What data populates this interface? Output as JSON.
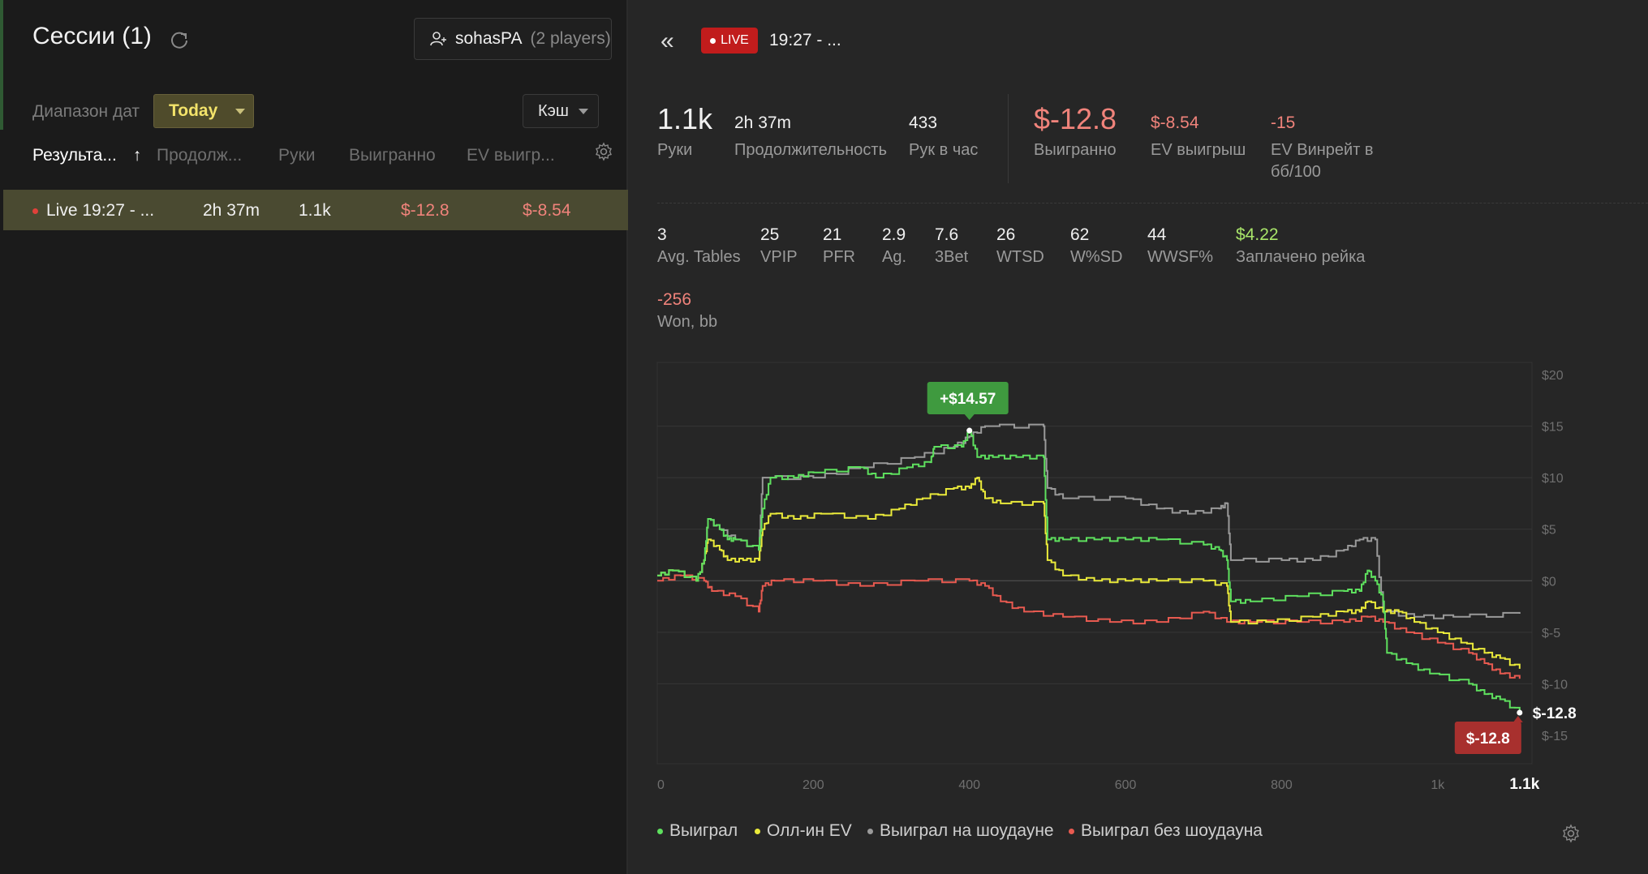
{
  "left": {
    "title": "Сессии (1)",
    "player": {
      "name": "sohasPA",
      "sub": "(2 players)"
    },
    "date_label": "Диапазон дат",
    "date_value": "Today",
    "game_type": "Кэш",
    "columns": [
      "Результа...",
      "Продолж...",
      "Руки",
      "Выигранно",
      "EV выигр..."
    ],
    "sort_arrow": "↑",
    "rows": [
      {
        "name": "Live 19:27 - ...",
        "duration": "2h 37m",
        "hands": "1.1k",
        "won": "$-12.8",
        "ev_won": "$-8.54"
      }
    ]
  },
  "header": {
    "live_label": "LIVE",
    "session_title": "19:27 - ..."
  },
  "stats": {
    "hands_value": "1.1k",
    "hands_label": "Руки",
    "duration_value": "2h 37m",
    "duration_label": "Продолжительность",
    "hph_value": "433",
    "hph_label": "Рук в час",
    "won_value": "$-12.8",
    "won_label": "Выигранно",
    "ev_value": "$-8.54",
    "ev_label": "EV выигрыш",
    "evwr_value": "-15",
    "evwr_label_1": "EV Винрейт в",
    "evwr_label_2": "бб/100",
    "row2": [
      {
        "v": "3",
        "l": "Avg. Tables"
      },
      {
        "v": "25",
        "l": "VPIP"
      },
      {
        "v": "21",
        "l": "PFR"
      },
      {
        "v": "2.9",
        "l": "Ag."
      },
      {
        "v": "7.6",
        "l": "3Bet"
      },
      {
        "v": "26",
        "l": "WTSD"
      },
      {
        "v": "62",
        "l": "W%SD"
      },
      {
        "v": "44",
        "l": "WWSF%"
      },
      {
        "v": "$4.22",
        "l": "Заплачено рейка"
      }
    ],
    "won_bb_value": "-256",
    "won_bb_label": "Won, bb"
  },
  "colors": {
    "won": "#5ee05e",
    "allin_ev": "#eaea3a",
    "showdown": "#9a9a9a",
    "non_showdown": "#e85a50",
    "peak_badge": "#3f9a3f",
    "end_badge": "#a8302e"
  },
  "chart_data": {
    "type": "line",
    "x_ticks": [
      "0",
      "200",
      "400",
      "600",
      "800",
      "1k"
    ],
    "x_end_label": "1.1k",
    "y_ticks": [
      "$20",
      "$15",
      "$10",
      "$5",
      "$0",
      "$-5",
      "$-10",
      "$-15"
    ],
    "xlim": [
      0,
      1100
    ],
    "ylim": [
      -15,
      20
    ],
    "grid": true,
    "peak_label": "+$14.57",
    "end_label": "$-12.8",
    "end_value_label": "$-12.8",
    "legend_position": "bottom-left",
    "series": [
      {
        "name": "Выиграл",
        "color_key": "won",
        "points": [
          [
            0,
            0.5
          ],
          [
            20,
            1
          ],
          [
            50,
            0
          ],
          [
            60,
            2
          ],
          [
            65,
            6
          ],
          [
            80,
            5
          ],
          [
            90,
            4
          ],
          [
            100,
            4
          ],
          [
            130,
            3
          ],
          [
            135,
            7
          ],
          [
            145,
            10
          ],
          [
            175,
            10
          ],
          [
            200,
            10.5
          ],
          [
            260,
            11
          ],
          [
            280,
            10
          ],
          [
            320,
            11
          ],
          [
            350,
            11.5
          ],
          [
            355,
            13
          ],
          [
            390,
            13
          ],
          [
            400,
            14.57
          ],
          [
            410,
            12
          ],
          [
            430,
            12
          ],
          [
            460,
            12
          ],
          [
            495,
            12
          ],
          [
            500,
            4
          ],
          [
            520,
            4
          ],
          [
            560,
            4
          ],
          [
            600,
            4
          ],
          [
            640,
            4
          ],
          [
            700,
            3.5
          ],
          [
            720,
            3
          ],
          [
            730,
            2
          ],
          [
            735,
            -2
          ],
          [
            760,
            -2
          ],
          [
            820,
            -1.5
          ],
          [
            880,
            -1
          ],
          [
            900,
            -1
          ],
          [
            910,
            1
          ],
          [
            920,
            0
          ],
          [
            930,
            -2
          ],
          [
            935,
            -7
          ],
          [
            960,
            -8
          ],
          [
            990,
            -9
          ],
          [
            1040,
            -10
          ],
          [
            1060,
            -11
          ],
          [
            1080,
            -11.5
          ],
          [
            1105,
            -12.8
          ]
        ]
      },
      {
        "name": "Олл-ин EV",
        "color_key": "allin_ev",
        "points": [
          [
            0,
            0.5
          ],
          [
            20,
            1
          ],
          [
            50,
            0
          ],
          [
            60,
            2
          ],
          [
            65,
            4
          ],
          [
            80,
            3
          ],
          [
            90,
            2
          ],
          [
            110,
            2
          ],
          [
            130,
            2
          ],
          [
            135,
            5
          ],
          [
            145,
            6.5
          ],
          [
            175,
            6
          ],
          [
            210,
            6.5
          ],
          [
            270,
            6
          ],
          [
            310,
            7
          ],
          [
            340,
            8
          ],
          [
            380,
            9
          ],
          [
            400,
            9
          ],
          [
            410,
            10
          ],
          [
            420,
            8
          ],
          [
            440,
            7.5
          ],
          [
            495,
            7.5
          ],
          [
            500,
            2
          ],
          [
            520,
            0.5
          ],
          [
            560,
            0
          ],
          [
            600,
            0
          ],
          [
            640,
            0
          ],
          [
            700,
            0
          ],
          [
            730,
            -0.5
          ],
          [
            735,
            -4
          ],
          [
            780,
            -4
          ],
          [
            840,
            -3.5
          ],
          [
            880,
            -3
          ],
          [
            900,
            -3
          ],
          [
            910,
            -2
          ],
          [
            930,
            -3
          ],
          [
            950,
            -3
          ],
          [
            970,
            -4
          ],
          [
            1000,
            -5
          ],
          [
            1030,
            -6
          ],
          [
            1060,
            -7
          ],
          [
            1080,
            -7.5
          ],
          [
            1105,
            -8.54
          ]
        ]
      },
      {
        "name": "Выиграл на шоудауне",
        "color_key": "showdown",
        "points": [
          [
            0,
            0.5
          ],
          [
            20,
            1
          ],
          [
            50,
            0
          ],
          [
            60,
            2
          ],
          [
            65,
            6
          ],
          [
            80,
            5
          ],
          [
            100,
            4
          ],
          [
            130,
            3
          ],
          [
            135,
            10
          ],
          [
            200,
            10
          ],
          [
            260,
            11
          ],
          [
            330,
            12
          ],
          [
            380,
            13
          ],
          [
            400,
            14
          ],
          [
            420,
            15
          ],
          [
            495,
            15
          ],
          [
            500,
            9
          ],
          [
            520,
            8
          ],
          [
            600,
            8
          ],
          [
            640,
            7
          ],
          [
            680,
            6.5
          ],
          [
            720,
            7
          ],
          [
            730,
            7.5
          ],
          [
            735,
            2
          ],
          [
            800,
            2
          ],
          [
            840,
            2
          ],
          [
            880,
            3
          ],
          [
            900,
            4
          ],
          [
            920,
            4
          ],
          [
            930,
            -3
          ],
          [
            970,
            -3.5
          ],
          [
            1020,
            -3.5
          ],
          [
            1105,
            -3.2
          ]
        ]
      },
      {
        "name": "Выиграл без шоудауна",
        "color_key": "non_showdown",
        "points": [
          [
            0,
            0
          ],
          [
            30,
            0.5
          ],
          [
            60,
            0
          ],
          [
            70,
            -1
          ],
          [
            100,
            -1.5
          ],
          [
            130,
            -3
          ],
          [
            135,
            -0.5
          ],
          [
            150,
            0
          ],
          [
            200,
            0
          ],
          [
            260,
            -0.5
          ],
          [
            330,
            0
          ],
          [
            400,
            0
          ],
          [
            420,
            -0.5
          ],
          [
            440,
            -2
          ],
          [
            470,
            -3
          ],
          [
            520,
            -3.5
          ],
          [
            580,
            -4
          ],
          [
            640,
            -4
          ],
          [
            700,
            -3
          ],
          [
            730,
            -4
          ],
          [
            760,
            -4
          ],
          [
            820,
            -4
          ],
          [
            880,
            -4
          ],
          [
            910,
            -3.5
          ],
          [
            930,
            -4
          ],
          [
            960,
            -5
          ],
          [
            1000,
            -6
          ],
          [
            1040,
            -7
          ],
          [
            1060,
            -8
          ],
          [
            1080,
            -9
          ],
          [
            1105,
            -9.5
          ]
        ]
      }
    ]
  }
}
